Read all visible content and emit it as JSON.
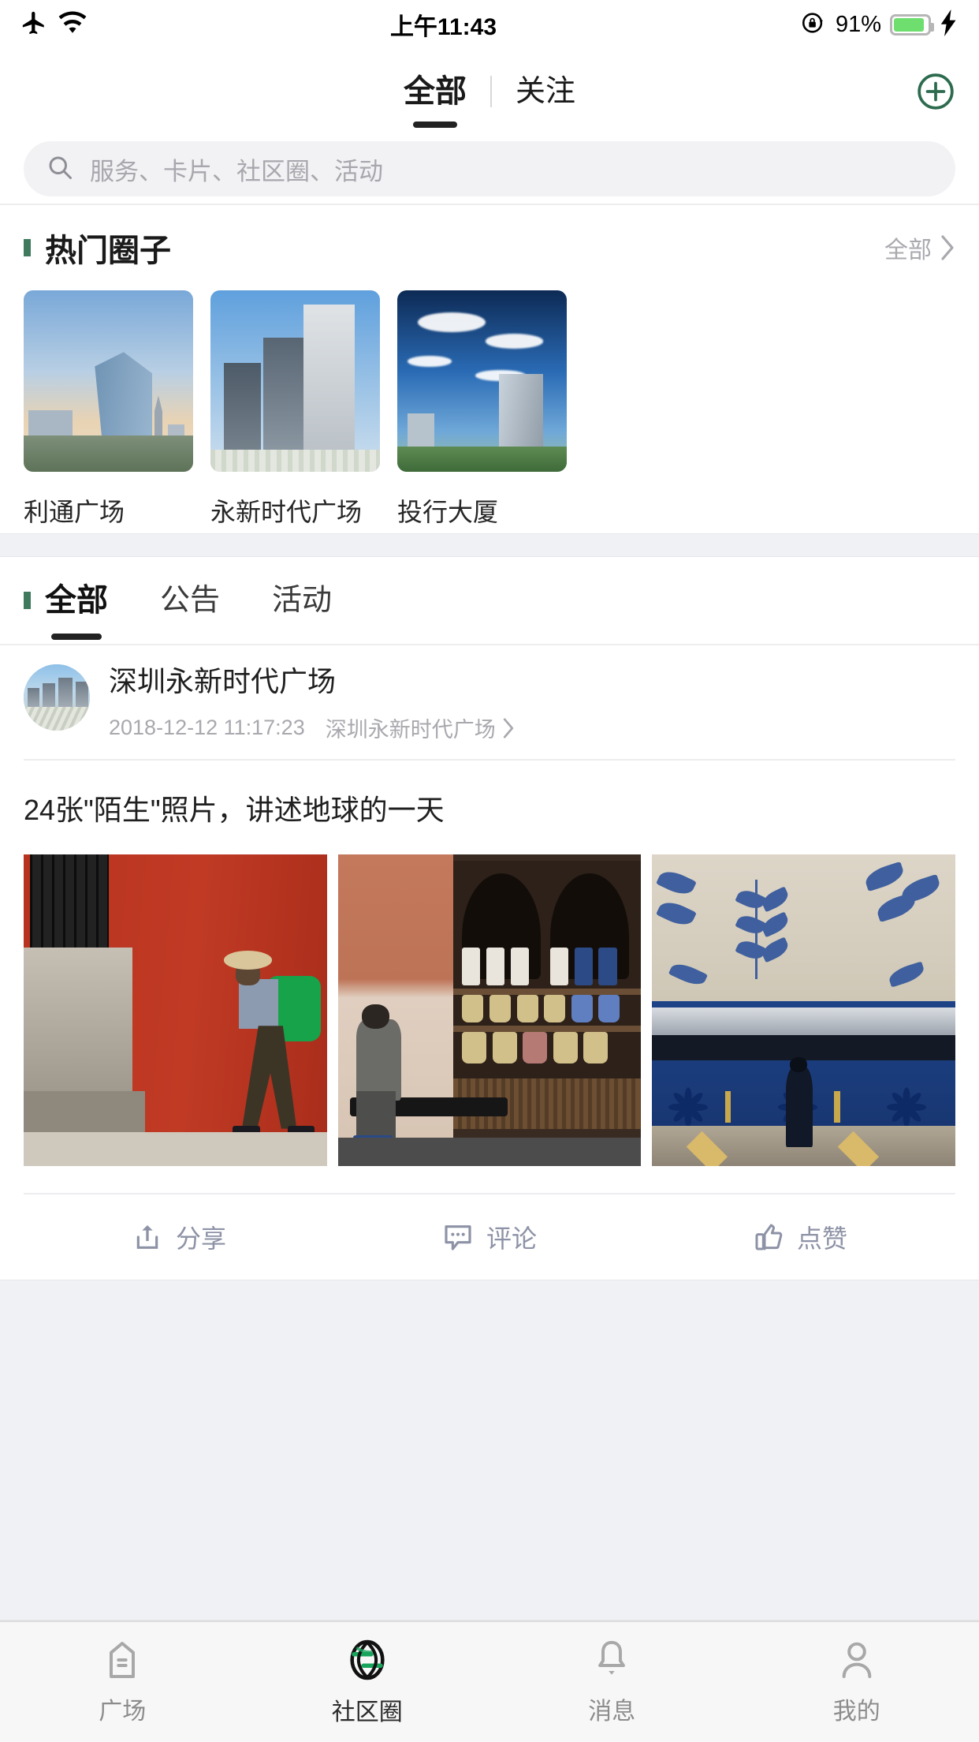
{
  "statusbar": {
    "airplane_icon": "airplane-icon",
    "wifi_icon": "wifi-icon",
    "time": "上午11:43",
    "rotation_lock_icon": "rotation-lock-icon",
    "battery_percent": "91%",
    "battery_level": 91,
    "battery_color": "#6ede6e",
    "charging_icon": "lightning-bolt-icon"
  },
  "header": {
    "tabs": [
      {
        "label": "全部",
        "active": true
      },
      {
        "label": "关注",
        "active": false
      }
    ],
    "add_icon": "plus-circle-icon",
    "accent_color": "#2d6b4f"
  },
  "search": {
    "icon": "search-icon",
    "placeholder": "服务、卡片、社区圈、活动",
    "value": ""
  },
  "hot_circles": {
    "title": "热门圈子",
    "marker_color": "#3f7a5c",
    "more_label": "全部",
    "more_icon": "chevron-right-icon",
    "cards": [
      {
        "label": "利通广场",
        "image": "glass-tower-skyline"
      },
      {
        "label": "永新时代广场",
        "image": "white-highrise-plaza"
      },
      {
        "label": "投行大厦",
        "image": "office-tower-blue-sky"
      }
    ]
  },
  "feed": {
    "marker_color": "#3f7a5c",
    "tabs": [
      {
        "label": "全部",
        "active": true
      },
      {
        "label": "公告",
        "active": false
      },
      {
        "label": "活动",
        "active": false
      }
    ],
    "posts": [
      {
        "author": "深圳永新时代广场",
        "avatar": "plaza-aerial-avatar",
        "time": "2018-12-12 11:17:23",
        "location": "深圳永新时代广场",
        "location_icon": "chevron-right-icon",
        "title": "24张\"陌生\"照片，讲述地球的一天",
        "photos": [
          {
            "alt": "man-with-green-sack-red-wall"
          },
          {
            "alt": "man-on-bench-spice-shop"
          },
          {
            "alt": "blue-metro-station-mural"
          }
        ],
        "actions": [
          {
            "label": "分享",
            "icon": "share-icon"
          },
          {
            "label": "评论",
            "icon": "comment-icon"
          },
          {
            "label": "点赞",
            "icon": "thumbs-up-icon"
          }
        ]
      }
    ]
  },
  "tabbar": {
    "items": [
      {
        "label": "广场",
        "icon": "building-home-icon",
        "active": false
      },
      {
        "label": "社区圈",
        "icon": "aperture-icon",
        "active": true
      },
      {
        "label": "消息",
        "icon": "bell-icon",
        "active": false
      },
      {
        "label": "我的",
        "icon": "person-icon",
        "active": false
      }
    ],
    "active_color": "#19a45c",
    "inactive_color": "#a8a8a8"
  }
}
